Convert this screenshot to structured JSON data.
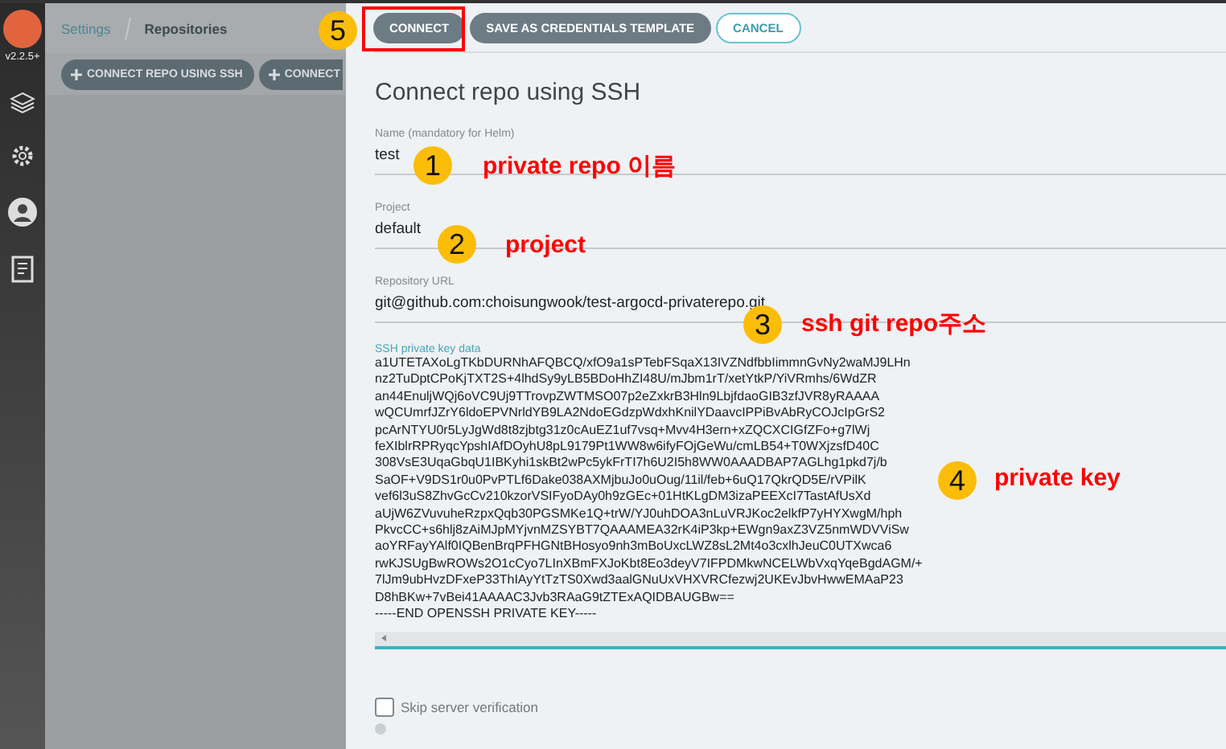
{
  "sidebar": {
    "version": "v2.2.5+"
  },
  "breadcrumb": [
    "Settings",
    "Repositories"
  ],
  "toolbar": {
    "buttons": [
      "CONNECT REPO USING SSH",
      "CONNECT"
    ]
  },
  "panel": {
    "buttons": [
      {
        "label": "CONNECT",
        "kind": "filled"
      },
      {
        "label": "SAVE AS CREDENTIALS TEMPLATE",
        "kind": "filled"
      },
      {
        "label": "CANCEL",
        "kind": "outline"
      }
    ],
    "title": "Connect repo using SSH",
    "fields": [
      {
        "label": "Name (mandatory for Helm)",
        "value": "test"
      },
      {
        "label": "Project",
        "value": "default"
      },
      {
        "label": "Repository URL",
        "value": "git@github.com:choisungwook/test-argocd-privaterepo.git"
      }
    ],
    "key_field": {
      "label": "SSH private key data",
      "lines": [
        "a1UTETAXoLgTKbDURNhAFQBCQ/xfO9a1sPTebFSqaX13IVZNdfbbIimmnGvNy2waMJ9LHn",
        "nz2TuDptCPoKjTXT2S+4lhdSy9yLB5BDoHhZI48U/mJbm1rT/xetYtkP/YiVRmhs/6WdZR",
        "an44EnuljWQj6oVC9Uj9TTrovpZWTMSO07p2eZxkrB3Hln9LbjfdaoGIB3zfJVR8yRAAAA",
        "wQCUmrfJZrY6ldoEPVNrldYB9LA2NdoEGdzpWdxhKnilYDaavcIPPiBvAbRyCOJcIpGrS2",
        "pcArNTYU0r5LyJgWd8t8zjbtg31z0cAuEZ1uf7vsq+Mvv4H3ern+xZQCXCIGfZFo+g7lWj",
        "feXIblrRPRyqcYpshIAfDOyhU8pL9179Pt1WW8w6ifyFOjGeWu/cmLB54+T0WXjzsfD40C",
        "308VsE3UqaGbqU1IBKyhi1skBt2wPc5ykFrTI7h6U2I5h8WW0AAADBAP7AGLhg1pkd7j/b",
        "SaOF+V9DS1r0u0PvPTLf6Dake038AXMjbuJo0uOug/11il/feb+6uQ17QkrQD5E/rVPilK",
        "vef6l3uS8ZhvGcCv210kzorVSIFyoDAy0h9zGEc+01HtKLgDM3izaPEEXcI7TastAfUsXd",
        "aUjW6ZVuvuheRzpxQqb30PGSMKe1Q+trW/YJ0uhDOA3nLuVRJKoc2elkfP7yHYXwgM/hph",
        "PkvcCC+s6hlj8zAiMJpMYjvnMZSYBT7QAAAMEA32rK4iP3kp+EWgn9axZ3VZ5nmWDVViSw",
        "aoYRFayYAlf0IQBenBrqPFHGNtBHosyo9nh3mBoUxcLWZ8sL2Mt4o3cxlhJeuC0UTXwca6",
        "rwKJSUgBwROWs2O1cCyo7LInXBmFXJoKbt8Eo3deyV7IFPDMkwNCELWbVxqYqeBgdAGM/+",
        "7lJm9ubHvzDFxeP33ThIAyYtTzTS0Xwd3aalGNuUxVHXVRCfezwj2UKEvJbvHwwEMAaP23",
        "D8hBKw+7vBei41AAAAC3Jvb3RAaG9tZTExAQIDBAUGBw==",
        "-----END OPENSSH PRIVATE KEY-----"
      ]
    },
    "checkbox": {
      "label": "Skip server verification",
      "checked": false
    }
  },
  "annotations": [
    {
      "number": "1",
      "note": "private repo 이름"
    },
    {
      "number": "2",
      "note": "project"
    },
    {
      "number": "3",
      "note": "ssh git repo주소"
    },
    {
      "number": "4",
      "note": "private key"
    },
    {
      "number": "5"
    }
  ]
}
